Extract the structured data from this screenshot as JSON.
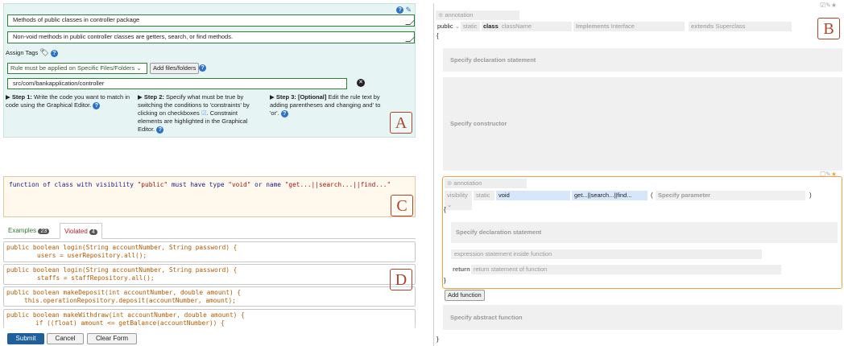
{
  "panelA": {
    "rule_name": "Methods of public classes in controller package",
    "rule_description": "Non-void methods in public controller classes are getters, search, or find methods.",
    "assign_tags_label": "Assign Tags",
    "scope_select": "Rule must be applied on Specific Files/Folders",
    "add_files_label": "Add files/folders",
    "path_value": "src/com/bankapplication/controller",
    "step1_title": "Step 1:",
    "step1_text": "Write the code you want to match in code using the Graphical Editor.",
    "step2_title": "Step 2:",
    "step2_text": "Specify what must be true by switching the conditions to 'constraints' by clicking on checkboxes",
    "step2_text2": ". Constraint elements are highlighted in the Graphical Editor.",
    "step3_title": "Step 3: [Optional]",
    "step3_text": "Edit the rule text by adding parentheses and changing and' to 'or'.",
    "label": "A"
  },
  "panelB": {
    "label": "B",
    "annotation": "annotation",
    "visibility": "public",
    "static": "static",
    "class_kw": "class",
    "class_name": "className",
    "implements_kw": "Implements",
    "interface": "Interface",
    "extends_kw": "extends",
    "superclass": "Superclass",
    "open_brace": "{",
    "close_brace": "}",
    "decl_placeholder": "Specify declaration statement",
    "constructor_placeholder": "Specify constructor",
    "fn_annotation": "annotation",
    "fn_visibility": "visibility",
    "fn_static": "static",
    "fn_type": "void",
    "fn_name": "get...||search...||find...",
    "fn_paren_open": "(",
    "fn_param_placeholder": "Specify parameter",
    "fn_paren_close": ")",
    "fn_decl_placeholder": "Specify declaration statement",
    "fn_expr_placeholder": "expression statement inside function",
    "return_kw": "return",
    "return_placeholder": "return statement of function",
    "add_function_label": "Add function",
    "abstract_placeholder": "Specify abstract function"
  },
  "panelC": {
    "label": "C",
    "rule_text": [
      {
        "t": "function of class with visibility ",
        "c": "plain"
      },
      {
        "t": "\"public\"",
        "c": "str"
      },
      {
        "t": " must have type ",
        "c": "plain"
      },
      {
        "t": "\"void\"",
        "c": "str"
      },
      {
        "t": " or name ",
        "c": "plain"
      },
      {
        "t": "\"get...||search...||find...\"",
        "c": "str"
      }
    ]
  },
  "tabs": {
    "examples_label": "Examples",
    "examples_count": "23",
    "violated_label": "Violated",
    "violated_count": "4"
  },
  "panelD": {
    "label": "D",
    "snippets": [
      {
        "line1": "public boolean login(String accountNumber, String password) {",
        "line2": "users = userRepository.all();"
      },
      {
        "line1": "public boolean login(String accountNumber, String password) {",
        "line2": "staffs = staffRepository.all();"
      },
      {
        "line1": "public boolean makeDeposit(int accountNumber, double amount) {",
        "line2": "this.operationRepository.deposit(accountNumber, amount);"
      },
      {
        "line1": "public boolean makeWithdraw(int accountNumber, double amount) {",
        "line2": "if ((float) amount <= getBalance(accountNumber)) {"
      }
    ]
  },
  "actions": {
    "submit": "Submit",
    "cancel": "Cancel",
    "clear": "Clear Form"
  },
  "colors": {
    "accent": "#1f5f9c",
    "constraint": "#f2a23b",
    "label": "#b0432b"
  }
}
